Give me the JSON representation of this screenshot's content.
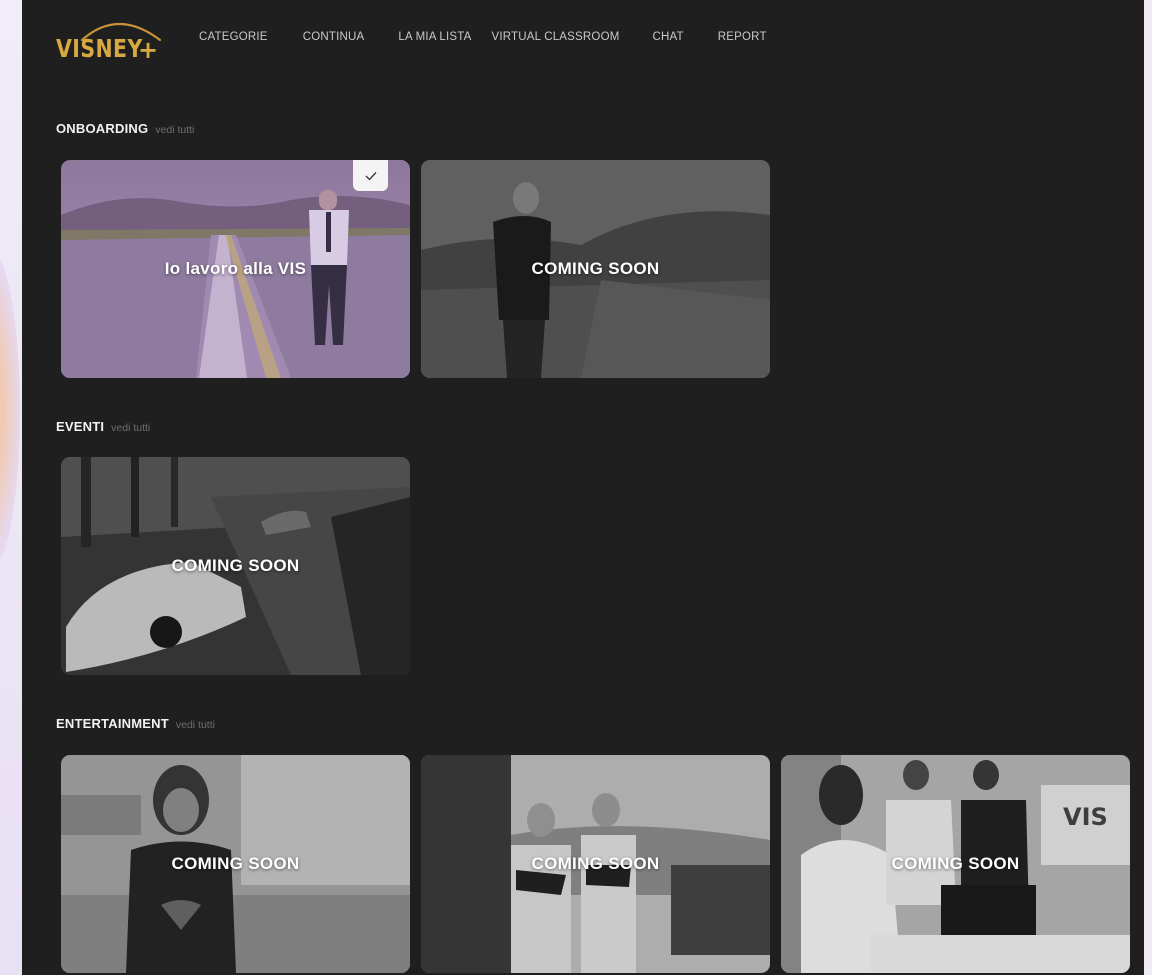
{
  "brand": {
    "name": "VISNEY",
    "plus": "+"
  },
  "nav": [
    "CATEGORIE",
    "CONTINUA",
    "LA MIA LISTA",
    "VIRTUAL CLASSROOM",
    "CHAT",
    "REPORT"
  ],
  "sections": [
    {
      "name": "ONBOARDING",
      "link": "vedi tutti",
      "cards": [
        {
          "label": "Io lavoro alla VIS",
          "watched": true,
          "tint": "#a98bc4"
        },
        {
          "label": "COMING SOON"
        }
      ]
    },
    {
      "name": "EVENTI",
      "link": "vedi tutti",
      "cards": [
        {
          "label": "COMING SOON"
        }
      ]
    },
    {
      "name": "ENTERTAINMENT",
      "link": "vedi tutti",
      "cards": [
        {
          "label": "COMING SOON"
        },
        {
          "label": "COMING SOON"
        },
        {
          "label": "COMING SOON"
        }
      ]
    }
  ],
  "colors": {
    "app_bg": "#1f1f1f",
    "brand_gold": "#d8a942",
    "nav_text": "#c9c9c9",
    "section_link": "#6f6f6f"
  },
  "icons": {
    "watched": "checkmark-icon"
  }
}
